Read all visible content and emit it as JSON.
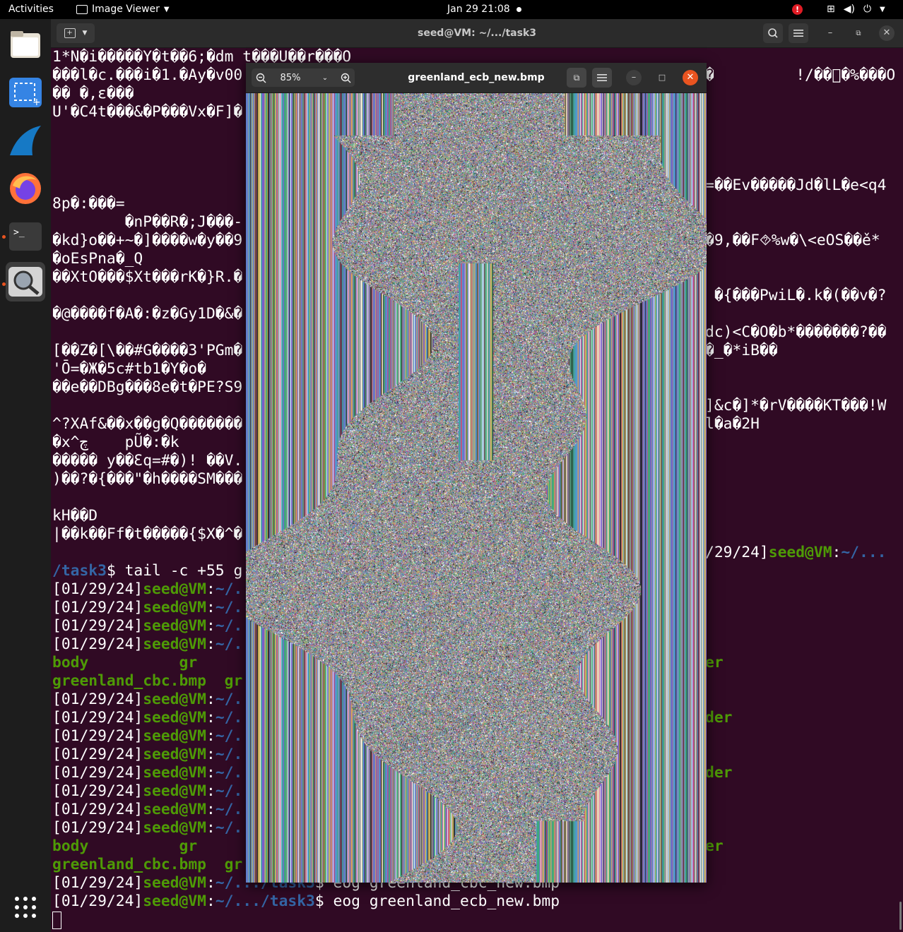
{
  "topbar": {
    "activities": "Activities",
    "app_name": "Image Viewer",
    "clock": "Jan 29  21:08",
    "alert": "!"
  },
  "terminal": {
    "title": "seed@VM: ~/.../task3",
    "lines": [
      {
        "row": 0,
        "segs": [
          {
            "t": "1*N�i�����Y�t��6;�dm t���U��r���O"
          }
        ]
      },
      {
        "row": 1,
        "segs": [
          {
            "t": "���l�c.���i�1.�Ay�v00"
          }
        ]
      },
      {
        "row": 2,
        "segs": [
          {
            "t": "�� �,ε���"
          }
        ]
      },
      {
        "row": 3,
        "segs": [
          {
            "t": "U'�C4t���&�P���Vx�F]�"
          }
        ]
      },
      {
        "row": 8,
        "segs": [
          {
            "t": "8p�:���="
          }
        ]
      },
      {
        "row": 9,
        "segs": [
          {
            "t": "        �nP��R�;J���-"
          }
        ]
      },
      {
        "row": 10,
        "segs": [
          {
            "t": "�kd}o��+~�]����w�y��9"
          }
        ]
      },
      {
        "row": 11,
        "segs": [
          {
            "t": "�oEsPna�_Q"
          }
        ]
      },
      {
        "row": 12,
        "segs": [
          {
            "t": "��XtO���$Xt���rK�}R.�"
          }
        ]
      },
      {
        "row": 14,
        "segs": [
          {
            "t": "�@����f�A�:�z�Gy1D�&�"
          }
        ]
      },
      {
        "row": 16,
        "segs": [
          {
            "t": "[��Z�[\\��#G����3'PGm�"
          }
        ]
      },
      {
        "row": 17,
        "segs": [
          {
            "t": "'Ō=�Ж�5c#tb1�Y�o�"
          }
        ]
      },
      {
        "row": 18,
        "segs": [
          {
            "t": "��e��DBg���8e�t�PE?S9"
          }
        ]
      },
      {
        "row": 20,
        "segs": [
          {
            "t": "^?XAf&��x��g�Q�������"
          }
        ]
      },
      {
        "row": 21,
        "segs": [
          {
            "t": "�x^چ    pŨ�:�k"
          }
        ]
      },
      {
        "row": 22,
        "segs": [
          {
            "t": "����� y��Ɛq=#�)! ��V."
          }
        ]
      },
      {
        "row": 23,
        "segs": [
          {
            "t": ")��?�{���\"�h����SM���"
          }
        ]
      },
      {
        "row": 25,
        "segs": [
          {
            "t": "kH��D"
          }
        ]
      },
      {
        "row": 26,
        "segs": [
          {
            "t": "|��k��Ff�t�����{$X�^�"
          }
        ]
      },
      {
        "row": 28,
        "segs": [
          {
            "t": "/task3",
            "c": "b"
          },
          {
            "t": "$ tail -c +55 g"
          }
        ]
      },
      {
        "row": 29,
        "segs": [
          {
            "t": "[01/29/24]"
          },
          {
            "t": "seed@VM",
            "c": "g"
          },
          {
            "t": ":"
          },
          {
            "t": "~/.",
            "c": "b"
          }
        ]
      },
      {
        "row": 30,
        "segs": [
          {
            "t": "[01/29/24]"
          },
          {
            "t": "seed@VM",
            "c": "g"
          },
          {
            "t": ":"
          },
          {
            "t": "~/.",
            "c": "b"
          }
        ]
      },
      {
        "row": 31,
        "segs": [
          {
            "t": "[01/29/24]"
          },
          {
            "t": "seed@VM",
            "c": "g"
          },
          {
            "t": ":"
          },
          {
            "t": "~/.",
            "c": "b"
          }
        ]
      },
      {
        "row": 32,
        "segs": [
          {
            "t": "[01/29/24]"
          },
          {
            "t": "seed@VM",
            "c": "g"
          },
          {
            "t": ":"
          },
          {
            "t": "~/.",
            "c": "b"
          }
        ]
      },
      {
        "row": 33,
        "segs": [
          {
            "t": "body",
            "c": "g"
          },
          {
            "t": "          "
          },
          {
            "t": "gr",
            "c": "g"
          }
        ]
      },
      {
        "row": 34,
        "segs": [
          {
            "t": "greenland_cbc.bmp",
            "c": "g"
          },
          {
            "t": "  "
          },
          {
            "t": "gr",
            "c": "g"
          }
        ]
      },
      {
        "row": 35,
        "segs": [
          {
            "t": "[01/29/24]"
          },
          {
            "t": "seed@VM",
            "c": "g"
          },
          {
            "t": ":"
          },
          {
            "t": "~/.",
            "c": "b"
          }
        ]
      },
      {
        "row": 36,
        "segs": [
          {
            "t": "[01/29/24]"
          },
          {
            "t": "seed@VM",
            "c": "g"
          },
          {
            "t": ":"
          },
          {
            "t": "~/.",
            "c": "b"
          }
        ]
      },
      {
        "row": 37,
        "segs": [
          {
            "t": "[01/29/24]"
          },
          {
            "t": "seed@VM",
            "c": "g"
          },
          {
            "t": ":"
          },
          {
            "t": "~/.",
            "c": "b"
          }
        ]
      },
      {
        "row": 38,
        "segs": [
          {
            "t": "[01/29/24]"
          },
          {
            "t": "seed@VM",
            "c": "g"
          },
          {
            "t": ":"
          },
          {
            "t": "~/.",
            "c": "b"
          }
        ]
      },
      {
        "row": 39,
        "segs": [
          {
            "t": "[01/29/24]"
          },
          {
            "t": "seed@VM",
            "c": "g"
          },
          {
            "t": ":"
          },
          {
            "t": "~/.",
            "c": "b"
          }
        ]
      },
      {
        "row": 40,
        "segs": [
          {
            "t": "[01/29/24]"
          },
          {
            "t": "seed@VM",
            "c": "g"
          },
          {
            "t": ":"
          },
          {
            "t": "~/.",
            "c": "b"
          }
        ]
      },
      {
        "row": 41,
        "segs": [
          {
            "t": "[01/29/24]"
          },
          {
            "t": "seed@VM",
            "c": "g"
          },
          {
            "t": ":"
          },
          {
            "t": "~/.",
            "c": "b"
          }
        ]
      },
      {
        "row": 42,
        "segs": [
          {
            "t": "[01/29/24]"
          },
          {
            "t": "seed@VM",
            "c": "g"
          },
          {
            "t": ":"
          },
          {
            "t": "~/.",
            "c": "b"
          }
        ]
      },
      {
        "row": 43,
        "segs": [
          {
            "t": "body",
            "c": "g"
          },
          {
            "t": "          "
          },
          {
            "t": "gr",
            "c": "g"
          }
        ]
      },
      {
        "row": 44,
        "segs": [
          {
            "t": "greenland_cbc.bmp",
            "c": "g"
          },
          {
            "t": "  "
          },
          {
            "t": "gr",
            "c": "g"
          }
        ]
      },
      {
        "row": 45,
        "segs": [
          {
            "t": "[01/29/24]"
          },
          {
            "t": "seed@VM",
            "c": "g"
          },
          {
            "t": ":"
          },
          {
            "t": "~/.../task3",
            "c": "b"
          },
          {
            "t": "$ eog greenland_cbc_new.bmp"
          }
        ]
      },
      {
        "row": 46,
        "segs": [
          {
            "t": "[01/29/24]"
          },
          {
            "t": "seed@VM",
            "c": "g"
          },
          {
            "t": ":"
          },
          {
            "t": "~/.../task3",
            "c": "b"
          },
          {
            "t": "$ eog greenland_ecb_new.bmp"
          }
        ]
      }
    ],
    "right_lines": [
      {
        "row": 1,
        "segs": [
          {
            "t": "�         !/��𪨙�%���O"
          }
        ]
      },
      {
        "row": 7,
        "segs": [
          {
            "t": "=��Ev�����Jd�lL�e<q4"
          }
        ]
      },
      {
        "row": 10,
        "segs": [
          {
            "t": "�9,��F⯑%w�\\<eOS��ě*"
          }
        ]
      },
      {
        "row": 13,
        "segs": [
          {
            "t": " �{���PwiL�.k�(��v�?"
          }
        ]
      },
      {
        "row": 15,
        "segs": [
          {
            "t": "dc)<C�O�b*�������?��"
          }
        ]
      },
      {
        "row": 16,
        "segs": [
          {
            "t": "�_�*iB��"
          }
        ]
      },
      {
        "row": 19,
        "segs": [
          {
            "t": "]&c�]*�rV����KT���!W"
          }
        ]
      },
      {
        "row": 20,
        "segs": [
          {
            "t": "l�a�2H"
          }
        ]
      },
      {
        "row": 27,
        "segs": [
          {
            "t": "/29/24]"
          },
          {
            "t": "seed@VM",
            "c": "g"
          },
          {
            "t": ":"
          },
          {
            "t": "~/...",
            "c": "b"
          }
        ]
      },
      {
        "row": 33,
        "segs": [
          {
            "t": "er",
            "c": "g"
          }
        ]
      },
      {
        "row": 36,
        "segs": [
          {
            "t": "der",
            "c": "g"
          }
        ]
      },
      {
        "row": 39,
        "segs": [
          {
            "t": "der",
            "c": "g"
          }
        ]
      },
      {
        "row": 43,
        "segs": [
          {
            "t": "er",
            "c": "g"
          }
        ]
      }
    ]
  },
  "viewer": {
    "zoom": "85%",
    "title": "greenland_ecb_new.bmp"
  },
  "dock": {
    "items": [
      "files-icon",
      "screenshot-icon",
      "wireshark-icon",
      "firefox-icon",
      "terminal-icon",
      "image-viewer-icon"
    ],
    "show_apps": "show-apps-icon"
  }
}
